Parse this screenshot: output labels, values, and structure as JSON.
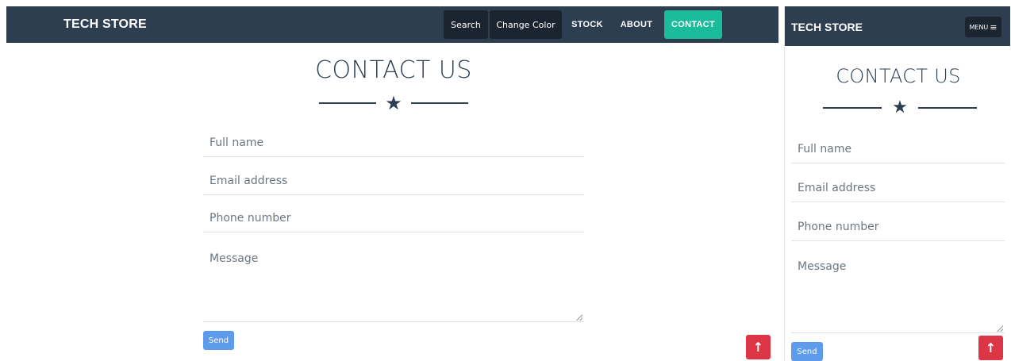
{
  "brand": "TECH STORE",
  "desktop": {
    "nav": {
      "search": "Search",
      "change_color": "Change Color",
      "stock": "STOCK",
      "about": "ABOUT",
      "contact": "CONTACT"
    }
  },
  "mobile": {
    "menu_label": "MENU",
    "menu_icon": "≡"
  },
  "contact": {
    "title": "CONTACT US",
    "star_icon": "★",
    "fields": {
      "full_name": "Full name",
      "email": "Email address",
      "phone": "Phone number",
      "message": "Message"
    },
    "send_label": "Send"
  },
  "scroll_top_icon": "↑",
  "colors": {
    "navbar": "#2c3e50",
    "nav_button": "#1a252f",
    "active_tab": "#1abc9c",
    "send_button": "#5d9cec",
    "scroll_top_button": "#dc3545"
  }
}
